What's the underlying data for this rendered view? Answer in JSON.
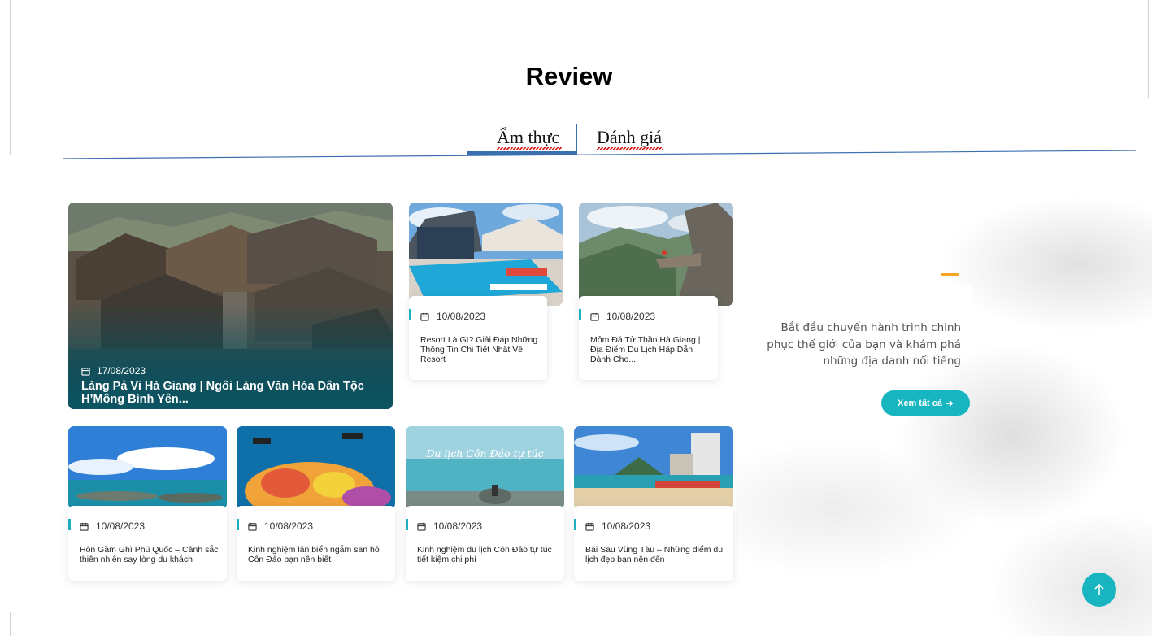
{
  "section": {
    "title": "Review"
  },
  "tabs": [
    {
      "label": "Ẩm thực",
      "active": true
    },
    {
      "label": "Đánh giá",
      "active": false
    }
  ],
  "featured": {
    "date": "17/08/2023",
    "title": "Làng Pả Vi Hà Giang | Ngôi Làng Văn Hóa Dân Tộc H’Mông Bình Yên..."
  },
  "top_cards": [
    {
      "date": "10/08/2023",
      "title": "Resort Là Gì? Giải Đáp Những Thông Tin Chi Tiết Nhất Về Resort"
    },
    {
      "date": "10/08/2023",
      "title": "Mỏm Đá Tử Thần Hà Giang | Địa Điểm Du Lịch Hấp Dẫn Dành Cho..."
    }
  ],
  "bottom_cards": [
    {
      "date": "10/08/2023",
      "title": "Hòn Gầm Ghì Phú Quốc – Cảnh sắc thiên nhiên say lòng du khách"
    },
    {
      "date": "10/08/2023",
      "title": "Kinh nghiệm lặn biển ngắm san hô Côn Đảo bạn nên biết"
    },
    {
      "date": "10/08/2023",
      "title": "Kinh nghiệm du lịch Côn Đảo tự túc tiết kiệm chi phí",
      "image_caption": "Du lịch Côn Đảo tự túc"
    },
    {
      "date": "10/08/2023",
      "title": "Bãi Sau Vũng Tàu – Những điểm du lịch đẹp bạn nên đến"
    }
  ],
  "sidebar": {
    "description": "Bắt đầu chuyến hành trình chinh phục thế giới của bạn và khám phá những địa danh nổi tiếng",
    "view_all_label": "Xem tất cả",
    "accent_color": "#f5a524",
    "button_color": "#16b5bf"
  },
  "icons": {
    "date": "calendar-icon",
    "view_all": "arrow-right-icon",
    "scroll_top": "arrow-up-icon"
  }
}
